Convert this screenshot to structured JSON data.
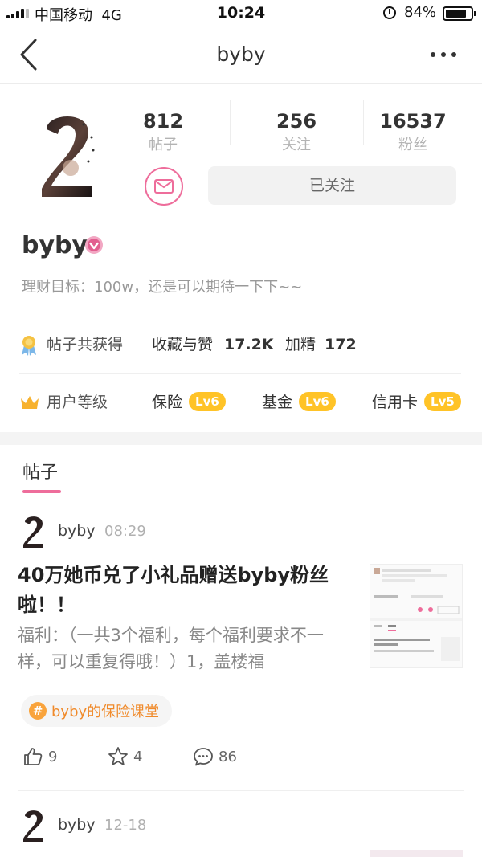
{
  "status_bar": {
    "carrier": "中国移动",
    "network": "4G",
    "time": "10:24",
    "battery": "84%",
    "battery_level": 0.84
  },
  "nav": {
    "title": "byby",
    "back_icon": "chevron-left-icon",
    "more_icon": "more-dots-icon"
  },
  "profile": {
    "stats": [
      {
        "value": "812",
        "label": "帖子"
      },
      {
        "value": "256",
        "label": "关注"
      },
      {
        "value": "16537",
        "label": "粉丝"
      }
    ],
    "follow_label": "已关注",
    "message_icon": "mail-icon",
    "username": "byby",
    "verified_icon": "verified-badge-icon",
    "bio": "理财目标：100w，还是可以期待一下下~~"
  },
  "achievements": {
    "icon": "medal-icon",
    "label": "帖子共获得",
    "favorites_label": "收藏与赞",
    "favorites_value": "17.2K",
    "featured_label": "加精",
    "featured_value": "172"
  },
  "levels": {
    "icon": "crown-icon",
    "label": "用户等级",
    "items": [
      {
        "name": "保险",
        "level": "Lv6"
      },
      {
        "name": "基金",
        "level": "Lv6"
      },
      {
        "name": "信用卡",
        "level": "Lv5"
      }
    ]
  },
  "tabs": {
    "active": "帖子"
  },
  "posts": [
    {
      "author": "byby",
      "time": "08:29",
      "title": "40万她币兑了小礼品赠送byby粉丝啦！！",
      "excerpt": "福利：（一共3个福利，每个福利要求不一样，可以重复得哦！）1，盖楼福",
      "topic": "byby的保险课堂",
      "likes": "9",
      "favorites": "4",
      "comments": "86"
    },
    {
      "author": "byby",
      "time": "12-18"
    }
  ],
  "colors": {
    "accent_pink": "#ee6d9b",
    "level_badge": "#ffc327",
    "topic_orange": "#f08a2a"
  }
}
